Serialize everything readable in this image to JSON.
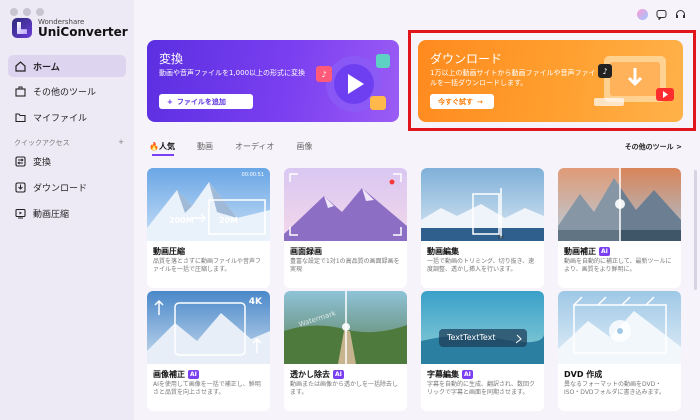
{
  "app": {
    "brand_small": "Wondershare",
    "brand_big": "UniConverter"
  },
  "sidebar": {
    "items": [
      {
        "label": "ホーム",
        "icon": "home-icon",
        "active": true
      },
      {
        "label": "その他のツール",
        "icon": "toolbox-icon",
        "active": false
      },
      {
        "label": "マイファイル",
        "icon": "folder-icon",
        "active": false
      }
    ],
    "quick_access_label": "クイックアクセス",
    "quick_access_add": "+",
    "quick_items": [
      {
        "label": "変換",
        "icon": "convert-icon"
      },
      {
        "label": "ダウンロード",
        "icon": "download-icon"
      },
      {
        "label": "動画圧縮",
        "icon": "compress-icon"
      }
    ]
  },
  "banners": {
    "convert": {
      "title": "変換",
      "desc": "動画や音声ファイルを1,000以上の形式に変換",
      "button": "ファイルを追加",
      "button_icon": "+"
    },
    "download": {
      "title": "ダウンロード",
      "desc": "1万以上の動画サイトから動画ファイルや音声ファイルを一括ダウンロードします。",
      "button": "今すぐ試す",
      "button_icon": "→"
    }
  },
  "tabs": [
    {
      "label": "人気",
      "active": true
    },
    {
      "label": "動画",
      "active": false
    },
    {
      "label": "オーディオ",
      "active": false
    },
    {
      "label": "画像",
      "active": false
    }
  ],
  "more_tools": "その他のツール >",
  "cards": [
    {
      "title": "動画圧縮",
      "ai": false,
      "desc": "品質を落とさずに動画ファイルや音声ファイルを一括で圧縮します。",
      "overlay_a": "200M",
      "overlay_b": "20M",
      "time": "00:00:51"
    },
    {
      "title": "画面録画",
      "ai": false,
      "desc": "豊富な設定で1対1の高品質の画面録画を実現"
    },
    {
      "title": "動画編集",
      "ai": false,
      "desc": "一括で動画のトリミング、切り抜き、速度調整、透かし挿入を行います。"
    },
    {
      "title": "動画補正",
      "ai": true,
      "desc": "動画を自動的に補正して、最新ツールにより、画質をより鮮明に。"
    },
    {
      "title": "画像補正",
      "ai": true,
      "desc": "AIを使用して画像を一括で補正し、鮮明さと品質を向上させます。",
      "overlay_a": "4K"
    },
    {
      "title": "透かし除去",
      "ai": true,
      "desc": "動画または画像から透かしを一括除去します。",
      "overlay_a": "Watermark"
    },
    {
      "title": "字幕編集",
      "ai": true,
      "desc": "字幕を自動的に生成、翻訳され、数回クリックで字幕と画面を同期させます。",
      "overlay_a": "TextTextText"
    },
    {
      "title": "DVD 作成",
      "ai": false,
      "desc": "異なるフォーマットの動画をDVD・ISO・DVDフォルダに書き込みます。"
    }
  ],
  "ai_badge": "AI",
  "colors": {
    "accent": "#7a3ff0",
    "convert_banner": "#5b2fe0",
    "download_banner": "#ff8a1e",
    "highlight": "#e1141b"
  }
}
